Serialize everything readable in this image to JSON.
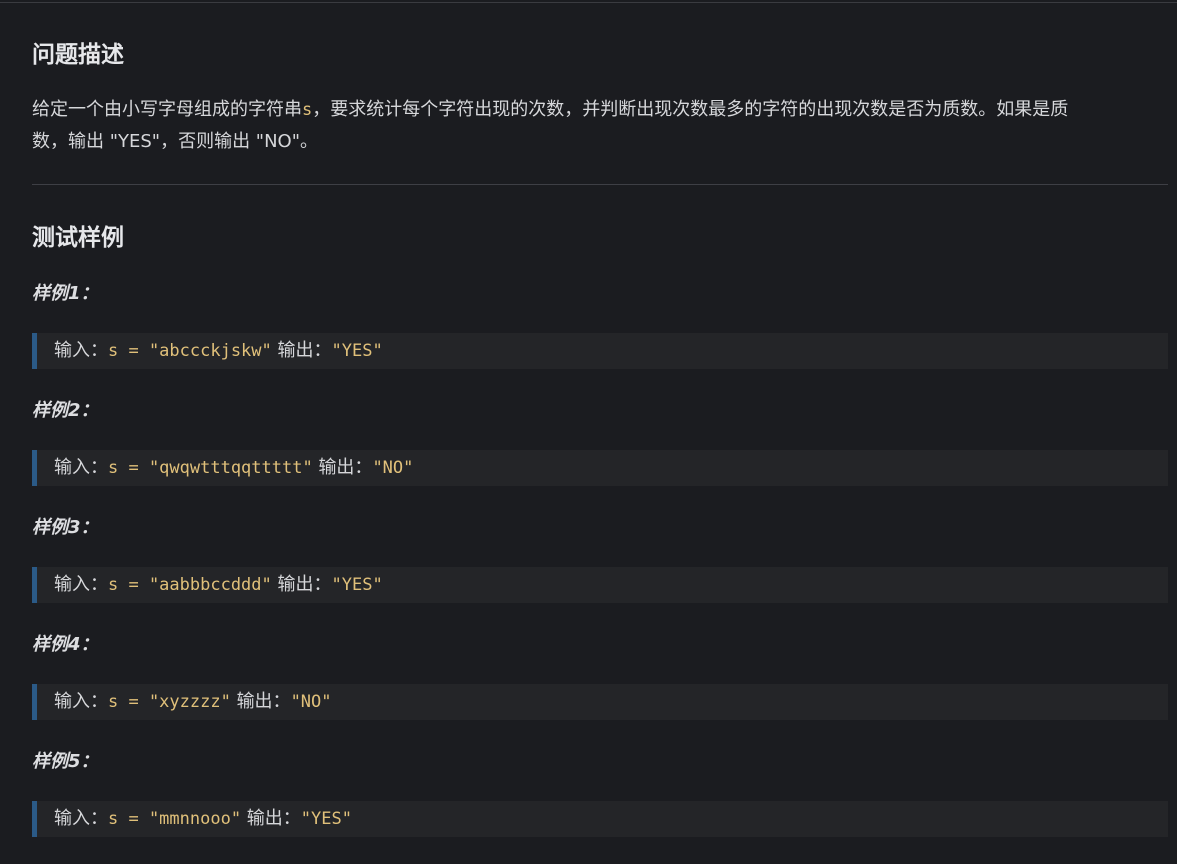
{
  "problem": {
    "heading": "问题描述",
    "desc_line1_before": "给定一个由小写字母组成的字符串",
    "desc_var": "s",
    "desc_line1_after": "，要求统计每个字符出现的次数，并判断出现次数最多的字符的出现次数是否为质数。如果是质",
    "desc_line2": "数，输出 \"YES\"，否则输出 \"NO\"。"
  },
  "tests": {
    "heading": "测试样例",
    "examples": [
      {
        "label": "样例1：",
        "input_prefix": "输入：",
        "input_code": "s = \"abccckjskw\"",
        "output_prefix": "输出：",
        "output_code": "\"YES\""
      },
      {
        "label": "样例2：",
        "input_prefix": "输入：",
        "input_code": "s = \"qwqwtttqqttttt\"",
        "output_prefix": "输出：",
        "output_code": "\"NO\""
      },
      {
        "label": "样例3：",
        "input_prefix": "输入：",
        "input_code": "s = \"aabbbccddd\"",
        "output_prefix": "输出：",
        "output_code": "\"YES\""
      },
      {
        "label": "样例4：",
        "input_prefix": "输入：",
        "input_code": "s = \"xyzzzz\"",
        "output_prefix": "输出：",
        "output_code": "\"NO\""
      },
      {
        "label": "样例5：",
        "input_prefix": "输入：",
        "input_code": "s = \"mmnnooo\"",
        "output_prefix": "输出：",
        "output_code": "\"YES\""
      }
    ]
  }
}
